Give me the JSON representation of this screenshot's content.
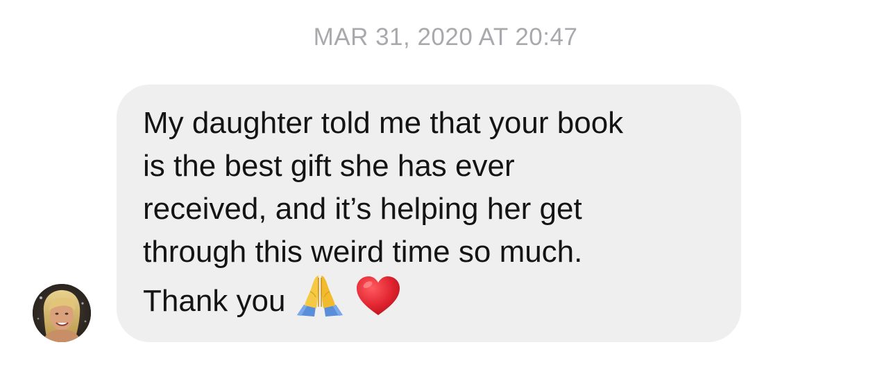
{
  "conversation": {
    "timestamp": "MAR 31, 2020 AT 20:47"
  },
  "message": {
    "lines": [
      "My daughter told me that your book",
      "is the best gift she has ever",
      "received, and it’s helping her get",
      "through this weird time so much.",
      "Thank you"
    ],
    "emojis": [
      "folded-hands",
      "red-heart"
    ]
  },
  "colors": {
    "bubble_background": "#efeff0",
    "timestamp_text": "#a8a8ad",
    "message_text": "#141414",
    "heart": "#e0242f",
    "hands": "#f6c944",
    "sleeve": "#5a8ed8"
  }
}
